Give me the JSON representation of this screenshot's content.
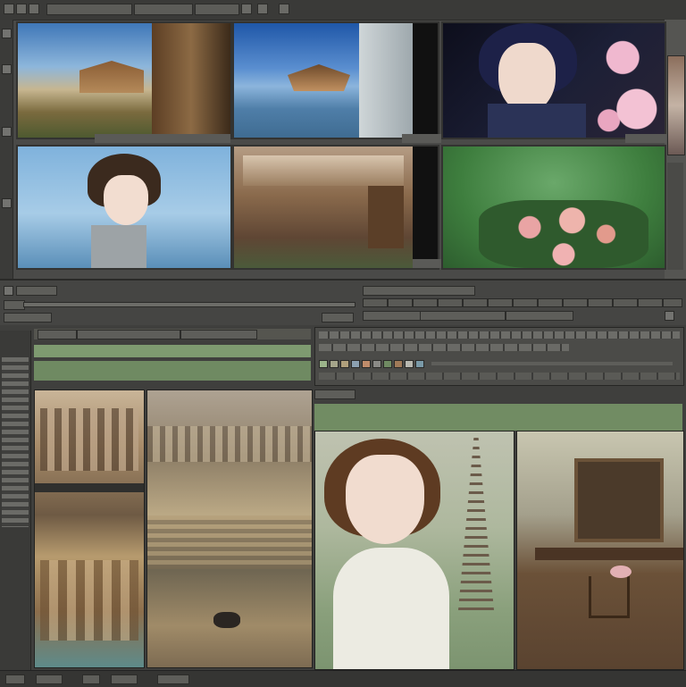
{
  "colors": {
    "chrome": "#3a3a38",
    "panel_bg": "#2f2f2d",
    "accent_green": "#7e9a70",
    "caption_bg": "#5a5a57"
  },
  "toolbar": {
    "icons": [
      "window-icon",
      "tool-icon",
      "layer-icon",
      "settings-icon"
    ]
  },
  "gallery": {
    "thumbnails": [
      {
        "name": "thumbnail-temple-landscape",
        "subject": "temple-landscape"
      },
      {
        "name": "thumbnail-pagoda-sea",
        "subject": "pagoda-sea"
      },
      {
        "name": "thumbnail-girl-blossoms",
        "subject": "girl-blossoms"
      },
      {
        "name": "thumbnail-boy-sky",
        "subject": "boy-sky"
      },
      {
        "name": "thumbnail-wooden-interior",
        "subject": "wooden-interior"
      },
      {
        "name": "thumbnail-pink-flowers",
        "subject": "pink-flowers"
      }
    ]
  },
  "editor": {
    "panels": [
      {
        "name": "preview-building-facade"
      },
      {
        "name": "preview-town-sketch"
      },
      {
        "name": "preview-girl-tower"
      },
      {
        "name": "preview-room-table"
      }
    ]
  }
}
